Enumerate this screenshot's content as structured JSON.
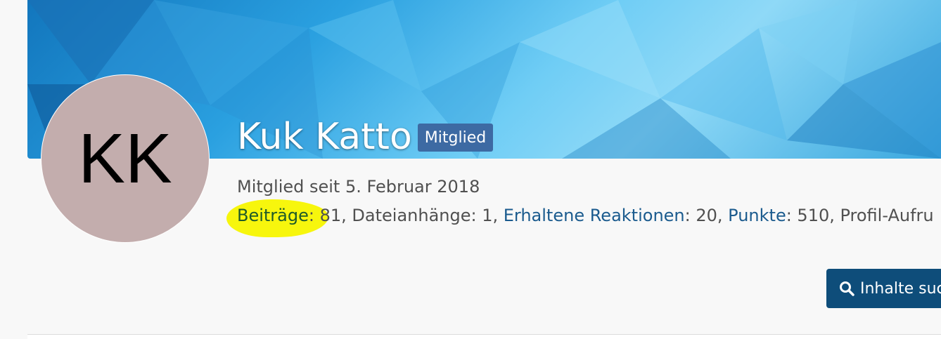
{
  "profile": {
    "avatar_initials": "KK",
    "name": "Kuk Katto",
    "badge": "Mitglied",
    "member_since": "Mitglied seit 5. Februar 2018"
  },
  "stats": {
    "posts_label": "Beiträge",
    "posts_value": ": 81, ",
    "attachments_text": "Dateianhänge: 1, ",
    "reactions_label": "Erhaltene Reaktionen",
    "reactions_value": ": 20, ",
    "points_label": "Punkte",
    "points_value": ": 510, ",
    "views_text": "Profil-Aufru"
  },
  "actions": {
    "search_label": "Inhalte suc"
  },
  "colors": {
    "highlight": "#f7f500",
    "button": "#0e4d7a",
    "badge": "#3d6aa3",
    "link": "#1b5b8e"
  }
}
